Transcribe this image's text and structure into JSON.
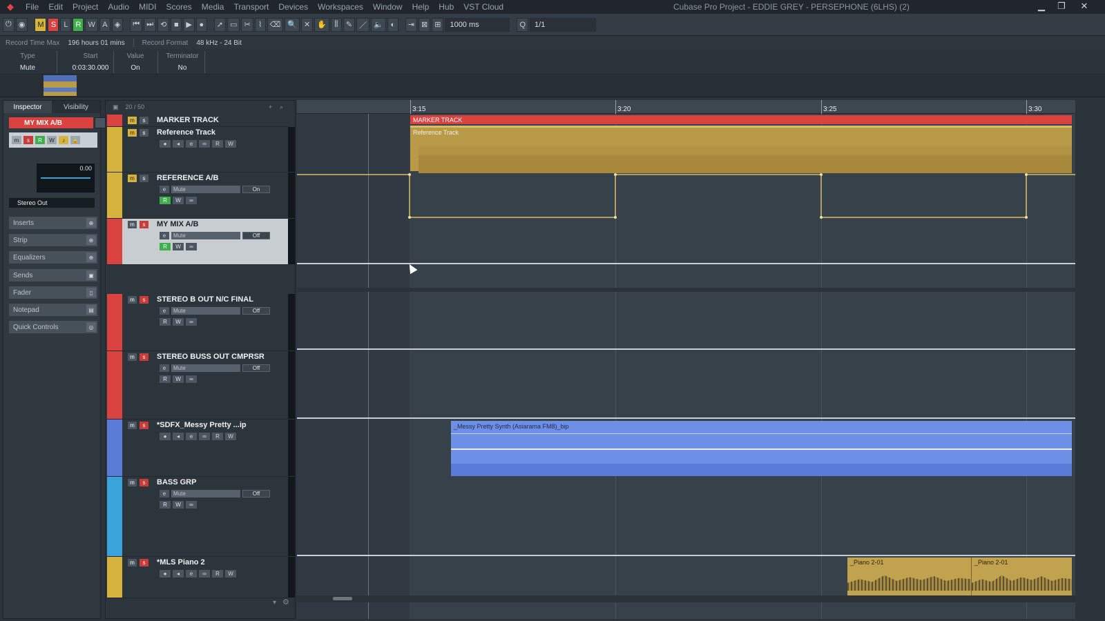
{
  "menubar": {
    "items": [
      "File",
      "Edit",
      "Project",
      "Audio",
      "MIDI",
      "Scores",
      "Media",
      "Transport",
      "Devices",
      "Workspaces",
      "Window",
      "Help",
      "Hub",
      "VST Cloud"
    ],
    "window_title": "Cubase Pro Project - EDDIE GREY - PERSEPHONE (6LHS) (2)"
  },
  "toolbar": {
    "mode_buttons": [
      "M",
      "S",
      "L",
      "R",
      "W",
      "A"
    ],
    "nudge_value": "1000 ms",
    "quantize_value": "1/1"
  },
  "infoline": {
    "record_time_label": "Record Time Max",
    "record_time_value": "196 hours 01 mins",
    "record_format_label": "Record Format",
    "record_format_value": "48 kHz - 24 Bit"
  },
  "event_info": {
    "type_label": "Type",
    "type_value": "Mute",
    "start_label": "Start",
    "start_value": "0:03:30.000",
    "value_label": "Value",
    "value_value": "On",
    "terminator_label": "Terminator",
    "terminator_value": "No"
  },
  "inspector": {
    "tab_inspector": "Inspector",
    "tab_visibility": "Visibility",
    "track_name": "MY MIX A/B",
    "fader_value": "0.00",
    "output": "Stereo Out",
    "sections": [
      "Inserts",
      "Strip",
      "Equalizers",
      "Sends",
      "Fader",
      "Notepad",
      "Quick Controls"
    ]
  },
  "tracklist": {
    "count": "20 / 50",
    "tracks": [
      {
        "name": "MARKER TRACK",
        "color": "#d9423f"
      },
      {
        "name": "Reference Track",
        "color": "#d6b33c"
      },
      {
        "name": "REFERENCE A/B",
        "color": "#d6b33c",
        "param": "Mute",
        "value": "On"
      },
      {
        "name": "MY MIX A/B",
        "color": "#d9423f",
        "param": "Mute",
        "value": "Off"
      },
      {
        "name": "STEREO B OUT N/C FINAL",
        "color": "#d9423f",
        "param": "Mute",
        "value": "Off"
      },
      {
        "name": "STEREO BUSS OUT CMPRSR",
        "color": "#d9423f",
        "param": "Mute",
        "value": "Off"
      },
      {
        "name": "*SDFX_Messy Pretty ...ip",
        "color": "#5a7cd8"
      },
      {
        "name": "BASS GRP",
        "color": "#3aa3dc",
        "param": "Mute",
        "value": "Off"
      },
      {
        "name": "*MLS Piano 2",
        "color": "#d6b33c"
      }
    ]
  },
  "ruler": {
    "labels": [
      "3:15",
      "3:20",
      "3:25",
      "3:30"
    ]
  },
  "events": {
    "marker": "MARKER TRACK",
    "reference": "Reference Track",
    "synth": "_Messy Pretty Synth (Asiarama FM8)_bip",
    "piano1": "_Piano 2-01",
    "piano2": "_Piano 2-01"
  },
  "colors": {
    "accent_red": "#d9423f",
    "accent_yellow": "#d6b33c",
    "accent_green": "#3fae4d",
    "synth_blue": "#6e8fe6"
  }
}
